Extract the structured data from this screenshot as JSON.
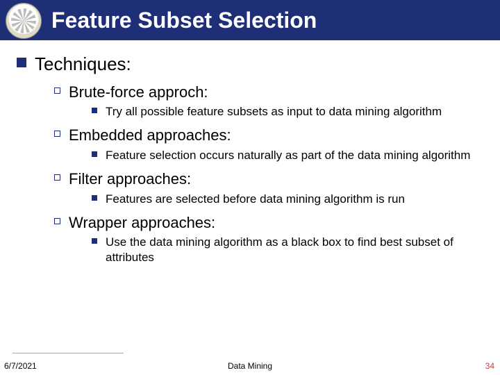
{
  "header": {
    "title": "Feature Subset Selection"
  },
  "content": {
    "heading": "Techniques:",
    "items": [
      {
        "title": "Brute-force approch:",
        "detail": "Try all possible feature subsets as input to data mining algorithm"
      },
      {
        "title": "Embedded approaches:",
        "detail": " Feature selection occurs naturally as part of the data mining algorithm"
      },
      {
        "title": "Filter approaches:",
        "detail": "Features are selected before data mining algorithm is run"
      },
      {
        "title": "Wrapper approaches:",
        "detail": " Use the data mining algorithm as a black box to find best subset of attributes"
      }
    ]
  },
  "footer": {
    "date": "6/7/2021",
    "center": "Data Mining",
    "page": "34"
  }
}
